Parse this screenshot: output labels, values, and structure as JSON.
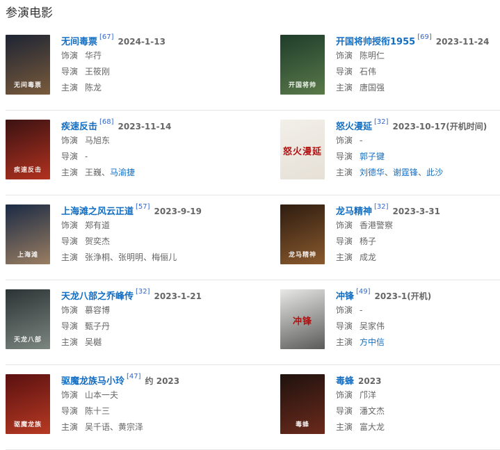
{
  "section_title": "参演电影",
  "labels": {
    "role": "饰演",
    "director": "导演",
    "star": "主演"
  },
  "movies": [
    {
      "title": "无间毒票",
      "score": "[67]",
      "date": "2024-1-13",
      "role": "华荇",
      "director": "王筱刚",
      "star": [
        "陈龙"
      ],
      "star_links": [
        false
      ],
      "director_link": false,
      "poster_colors": [
        "#1d2433",
        "#7a5b3c"
      ],
      "poster_text": "无间毒票"
    },
    {
      "title": "开国将帅授衔1955",
      "score": "[69]",
      "date": "2023-11-24",
      "role": "陈明仁",
      "director": "石伟",
      "star": [
        "唐国强"
      ],
      "star_links": [
        false
      ],
      "director_link": false,
      "poster_colors": [
        "#1f3c2a",
        "#5a7a4a"
      ],
      "poster_text": "开国将帅"
    },
    {
      "title": "疾速反击",
      "score": "[68]",
      "date": "2023-11-14",
      "role": "马旭东",
      "director": "-",
      "star": [
        "王巍",
        "马渝捷"
      ],
      "star_links": [
        false,
        true
      ],
      "director_link": false,
      "poster_colors": [
        "#3a1212",
        "#b2321f"
      ],
      "poster_text": "疾速反击"
    },
    {
      "title": "怒火漫延",
      "score": "[32]",
      "date": "2023-10-17(开机时间)",
      "role": "-",
      "director": "郭子键",
      "star": [
        "刘德华",
        "谢霆锋",
        "此沙"
      ],
      "star_links": [
        true,
        true,
        true
      ],
      "director_link": true,
      "poster_colors": [
        "#f2efe9",
        "#e6e0d6"
      ],
      "poster_text": "怒火漫延"
    },
    {
      "title": "上海滩之风云正道",
      "score": "[57]",
      "date": "2023-9-19",
      "role": "郑有道",
      "director": "贺奕杰",
      "star": [
        "张浄桐",
        "张明明",
        "梅俪儿"
      ],
      "star_links": [
        false,
        false,
        false
      ],
      "director_link": false,
      "poster_colors": [
        "#1a2a44",
        "#9b7e62"
      ],
      "poster_text": "上海滩"
    },
    {
      "title": "龙马精神",
      "score": "[32]",
      "date": "2023-3-31",
      "role": "香港警察",
      "director": "杨子",
      "star": [
        "成龙"
      ],
      "star_links": [
        false
      ],
      "director_link": false,
      "poster_colors": [
        "#2e1c10",
        "#8a5a2e"
      ],
      "poster_text": "龙马精神"
    },
    {
      "title": "天龙八部之乔峰传",
      "score": "[32]",
      "date": "2023-1-21",
      "role": "慕容博",
      "director": "甄子丹",
      "star": [
        "吴樾"
      ],
      "star_links": [
        false
      ],
      "director_link": false,
      "poster_colors": [
        "#2b3334",
        "#7c8680"
      ],
      "poster_text": "天龙八部"
    },
    {
      "title": "冲锋",
      "score": "[49]",
      "date": "2023-1(开机)",
      "role": "-",
      "director": "吴家伟",
      "star": [
        "方中信"
      ],
      "star_links": [
        true
      ],
      "director_link": false,
      "poster_colors": [
        "#e8e8e6",
        "#5a5a58"
      ],
      "poster_text": "冲锋"
    },
    {
      "title": "驱魔龙族马小玲",
      "score": "[47]",
      "date": "约 2023",
      "role": "山本一夫",
      "director": "陈十三",
      "star": [
        "吴千语",
        "黄宗泽"
      ],
      "star_links": [
        false,
        false
      ],
      "director_link": false,
      "poster_colors": [
        "#5a1010",
        "#b73a23"
      ],
      "poster_text": "驱魔龙族"
    },
    {
      "title": "毒蜂",
      "score": "",
      "date": "2023",
      "role": "邝洋",
      "director": "潘文杰",
      "star": [
        "富大龙"
      ],
      "star_links": [
        false
      ],
      "director_link": false,
      "poster_colors": [
        "#1f120e",
        "#6b2a1c"
      ],
      "poster_text": "毒蜂"
    }
  ]
}
